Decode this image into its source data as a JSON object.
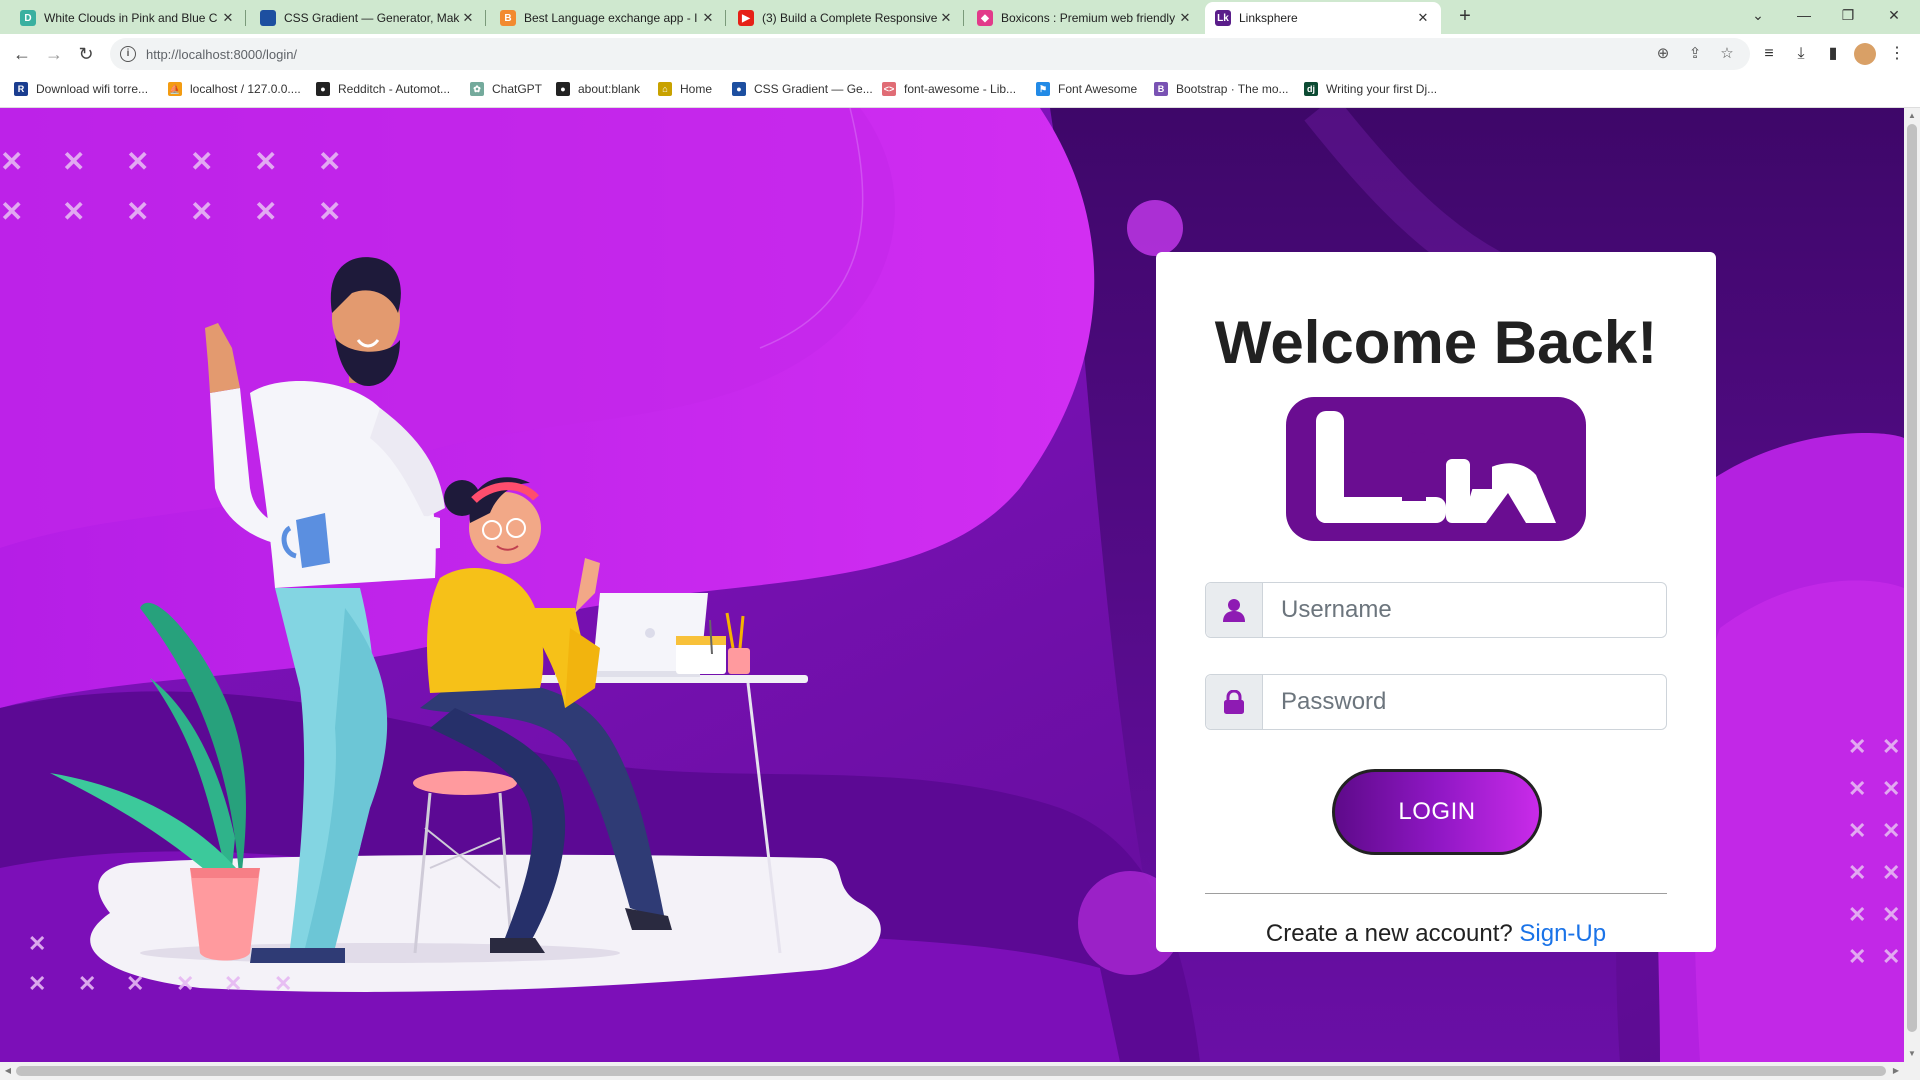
{
  "browser": {
    "tabs": [
      {
        "title": "White Clouds in Pink and Blue C",
        "favicon": "design-favicon",
        "color": "#3ab0a0",
        "letter": "D"
      },
      {
        "title": "CSS Gradient — Generator, Mak",
        "favicon": "globe-favicon",
        "color": "#1d4fa0",
        "letter": ""
      },
      {
        "title": "Best Language exchange app - I",
        "favicon": "app-favicon",
        "color": "#f28a30",
        "letter": "B"
      },
      {
        "title": "(3) Build a Complete Responsive",
        "favicon": "youtube-favicon",
        "color": "#e62117",
        "letter": "▶"
      },
      {
        "title": "Boxicons : Premium web friendly",
        "favicon": "boxicons-favicon",
        "color": "#e23a8a",
        "letter": "◆"
      },
      {
        "title": "Linksphere",
        "favicon": "linksphere-favicon",
        "color": "#5a1d8a",
        "letter": "Lk"
      }
    ],
    "active_tab_index": 5,
    "url": "http://localhost:8000/login/",
    "bookmarks": [
      {
        "label": "Download wifi torre...",
        "icon": "r-icon",
        "color": "#1a3d8f",
        "letter": "R"
      },
      {
        "label": "localhost / 127.0.0....",
        "icon": "phpmyadmin-icon",
        "color": "#f39c12",
        "letter": "⛵"
      },
      {
        "label": "Redditch - Automot...",
        "icon": "globe-icon",
        "color": "#222",
        "letter": "●"
      },
      {
        "label": "ChatGPT",
        "icon": "chatgpt-icon",
        "color": "#74aa9c",
        "letter": "✿"
      },
      {
        "label": "about:blank",
        "icon": "globe-icon",
        "color": "#222",
        "letter": "●"
      },
      {
        "label": "Home",
        "icon": "home-icon",
        "color": "#c8a200",
        "letter": "⌂"
      },
      {
        "label": "CSS Gradient — Ge...",
        "icon": "cssgradient-icon",
        "color": "#1d4fa0",
        "letter": "●"
      },
      {
        "label": "font-awesome - Lib...",
        "icon": "code-icon",
        "color": "#e06c75",
        "letter": "<>"
      },
      {
        "label": "Font Awesome",
        "icon": "flag-icon",
        "color": "#228ae6",
        "letter": "⚑"
      },
      {
        "label": "Bootstrap · The mo...",
        "icon": "bootstrap-icon",
        "color": "#7952b3",
        "letter": "B"
      },
      {
        "label": "Writing your first Dj...",
        "icon": "django-icon",
        "color": "#0c4b33",
        "letter": "dj"
      }
    ]
  },
  "login": {
    "heading": "Welcome Back!",
    "username_placeholder": "Username",
    "password_placeholder": "Password",
    "login_label": "LOGIN",
    "signup_prompt": "Create a new account?",
    "signup_link": "Sign-Up"
  },
  "colors": {
    "brand": "#6a0d91",
    "accent": "#a020d0",
    "link": "#1a73e8"
  }
}
